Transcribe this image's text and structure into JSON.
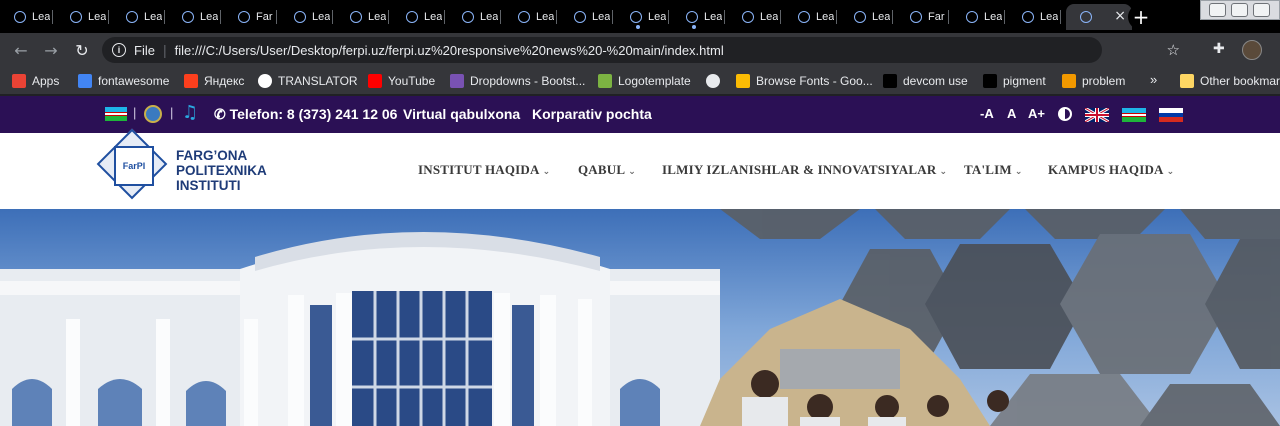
{
  "browser": {
    "tabs": [
      {
        "title": "Lea"
      },
      {
        "title": "Lea"
      },
      {
        "title": "Lea"
      },
      {
        "title": "Lea"
      },
      {
        "title": "Far"
      },
      {
        "title": "Lea"
      },
      {
        "title": "Lea"
      },
      {
        "title": "Lea"
      },
      {
        "title": "Lea"
      },
      {
        "title": "Lea"
      },
      {
        "title": "Lea"
      },
      {
        "title": "Lea"
      },
      {
        "title": "Lea"
      },
      {
        "title": "Lea"
      },
      {
        "title": "Lea"
      },
      {
        "title": "Lea"
      },
      {
        "title": "Far"
      },
      {
        "title": "Lea"
      },
      {
        "title": "Lea"
      }
    ],
    "active_tab_close": "×",
    "new_tab": "+",
    "address": {
      "scheme": "File",
      "url": "file:///C:/Users/User/Desktop/ferpi.uz/ferpi.uz%20responsive%20news%20-%20main/index.html"
    },
    "bookmarks": [
      {
        "label": "Apps",
        "icon": "apps-grid-icon",
        "color": "#ea4335"
      },
      {
        "label": "fontawesome",
        "icon": "flag-icon",
        "color": "#4285f4"
      },
      {
        "label": "Яндекс",
        "icon": "yandex-icon",
        "color": "#fc3f1d"
      },
      {
        "label": "TRANSLATOR",
        "icon": "google-icon",
        "color": "#ffffff"
      },
      {
        "label": "YouTube",
        "icon": "youtube-icon",
        "color": "#ff0000"
      },
      {
        "label": "Dropdowns - Bootst...",
        "icon": "bootstrap-icon",
        "color": "#7952b3"
      },
      {
        "label": "Logotemplate",
        "icon": "leaf-icon",
        "color": "#7cb342"
      },
      {
        "label": "",
        "icon": "globe-icon",
        "color": "#e8eaed"
      },
      {
        "label": "Browse Fonts - Goo...",
        "icon": "google-fonts-icon",
        "color": "#fbbc04"
      },
      {
        "label": "devcom use",
        "icon": "dev-icon",
        "color": "#000000"
      },
      {
        "label": "pigment",
        "icon": "drop-icon",
        "color": "#000000"
      },
      {
        "label": "problem",
        "icon": "page-icon",
        "color": "#f29900"
      },
      {
        "label": "Other bookmarks",
        "icon": "folder-icon",
        "color": "#fdd663"
      }
    ],
    "bookmarks_more": "»"
  },
  "site": {
    "topbar": {
      "phone": "Telefon: 8 (373) 241 12 06",
      "virtual": "Virtual qabulxona",
      "mail": "Korparativ pochta",
      "font_decrease": "-A",
      "font_normal": "A",
      "font_increase": "A+",
      "separator": "|"
    },
    "logo": {
      "line1": "FARG’ONA",
      "line2": "POLITEXNIKA",
      "line3": "INSTITUTI",
      "emblem_text": "FarPI"
    },
    "nav": [
      {
        "label": "INSTITUT HAQIDA"
      },
      {
        "label": "QABUL"
      },
      {
        "label": "ILMIY IZLANISHLAR & INNOVATSIYALAR"
      },
      {
        "label": "TA'LIM"
      },
      {
        "label": "KAMPUS HAQIDA"
      }
    ],
    "chevron": "⌄"
  },
  "colors": {
    "topbar_bg": "#2b1055",
    "nav_text": "#3a3a3a",
    "logo_blue": "#1e3b78"
  }
}
